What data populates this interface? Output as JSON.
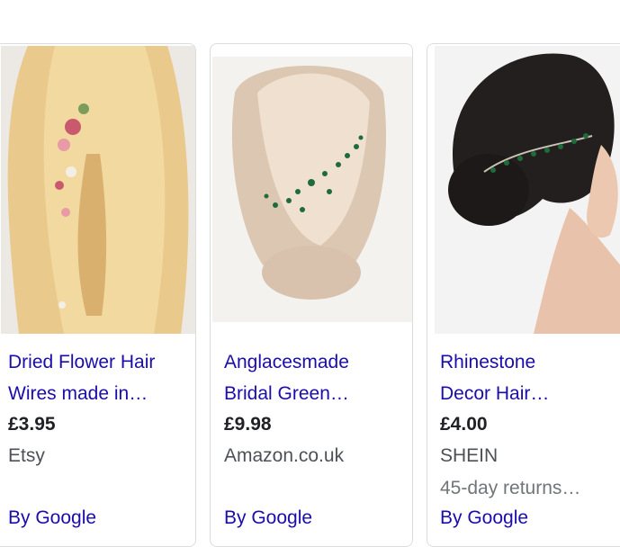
{
  "products": [
    {
      "title_line1": "Dried Flower Hair",
      "title_line2": "Wires made in…",
      "price": "£3.95",
      "merchant": "Etsy",
      "by": "By Google"
    },
    {
      "title_line1": "Anglacesmade",
      "title_line2": "Bridal Green…",
      "price": "£9.98",
      "merchant": "Amazon.co.uk",
      "by": "By Google"
    },
    {
      "title_line1": "Rhinestone",
      "title_line2": "Decor Hair…",
      "price": "£4.00",
      "merchant": "SHEIN",
      "extra": "45-day returns…",
      "by": "By Google"
    }
  ],
  "colors": {
    "link": "#1a0dab",
    "price": "#202124",
    "merchant": "#4d5156",
    "border": "#dadce0"
  }
}
